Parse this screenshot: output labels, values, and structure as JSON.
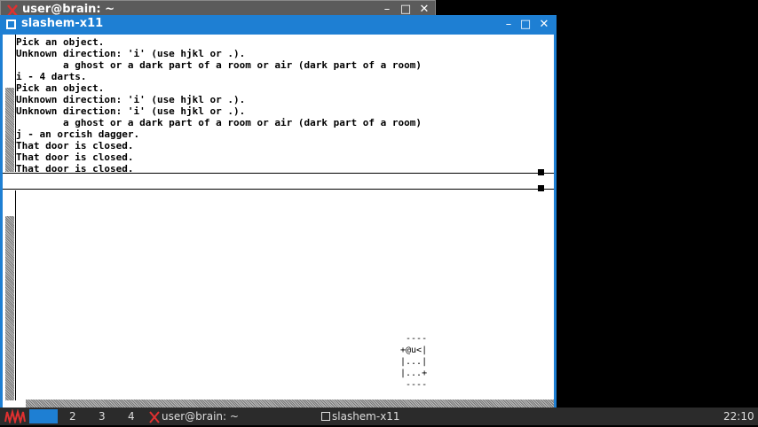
{
  "background_window": {
    "title": "user@brain: ~",
    "minimize": "–",
    "maximize": "□",
    "close": "✕"
  },
  "main_window": {
    "title": "slashem-x11",
    "minimize": "–",
    "maximize": "□",
    "close": "✕"
  },
  "messages": [
    "Pick an object.",
    "Unknown direction: 'i' (use hjkl or .).",
    "        a ghost or a dark part of a room or air (dark part of a room)",
    "i - 4 darts.",
    "Pick an object.",
    "Unknown direction: 'i' (use hjkl or .).",
    "Unknown direction: 'i' (use hjkl or .).",
    "        a ghost or a dark part of a room or air (dark part of a room)",
    "j - an orcish dagger.",
    "That door is closed.",
    "That door is closed.",
    "That door is closed."
  ],
  "map": {
    "rows": [
      " ----",
      "+@u<|",
      "|...|",
      "|...+",
      " ----"
    ]
  },
  "taskbar": {
    "workspaces": [
      "2",
      "3",
      "4"
    ],
    "tasks": [
      {
        "label": "user@brain: ~"
      },
      {
        "label": "slashem-x11"
      }
    ],
    "clock": "22:10"
  },
  "colors": {
    "title_active": "#1e7fd3",
    "title_inactive": "#5b5b5b",
    "taskbar": "#2b2b2b",
    "workspace_active": "#1e7fd3"
  }
}
